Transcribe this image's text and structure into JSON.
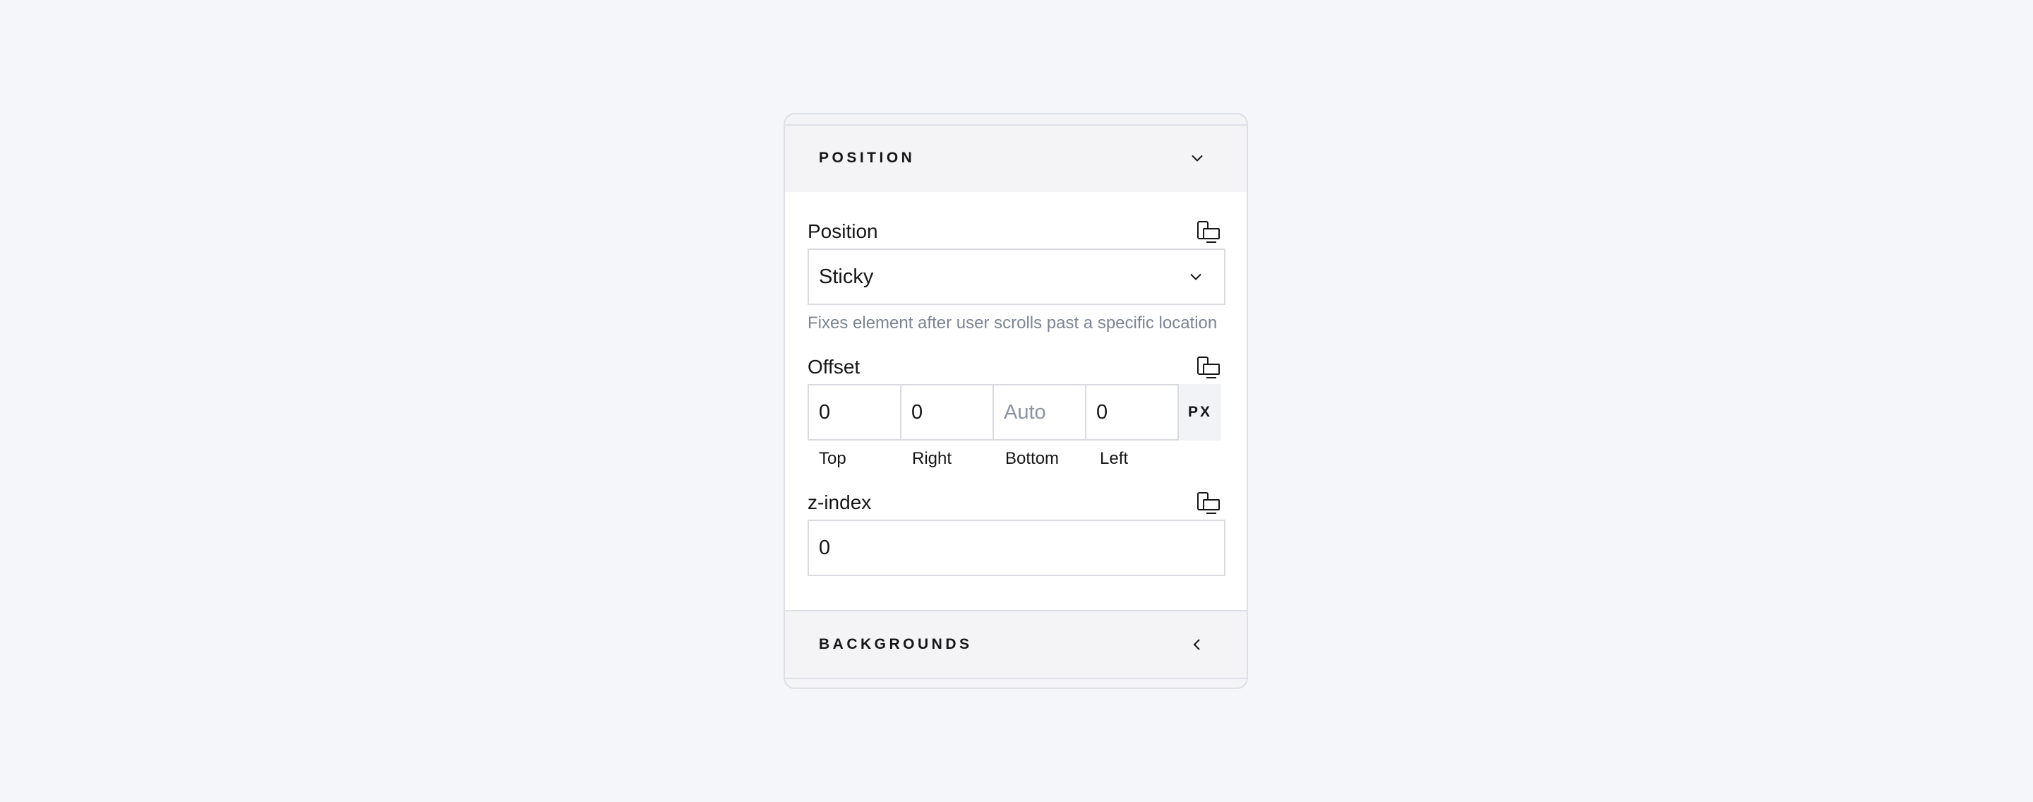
{
  "position_section": {
    "title": "POSITION",
    "chevron": "chevron-down-icon"
  },
  "position_field": {
    "label": "Position",
    "value": "Sticky",
    "helper": "Fixes element after user scrolls past a specific location",
    "icon": "responsive-devices-icon"
  },
  "offset_field": {
    "label": "Offset",
    "icon": "responsive-devices-icon",
    "unit": "PX",
    "cells": [
      {
        "value": "0",
        "caption": "Top"
      },
      {
        "value": "0",
        "caption": "Right"
      },
      {
        "value": "Auto",
        "caption": "Bottom"
      },
      {
        "value": "0",
        "caption": "Left"
      }
    ]
  },
  "zindex_field": {
    "label": "z-index",
    "value": "0",
    "icon": "responsive-devices-icon"
  },
  "backgrounds_section": {
    "title": "BACKGROUNDS",
    "chevron": "chevron-left-icon"
  }
}
